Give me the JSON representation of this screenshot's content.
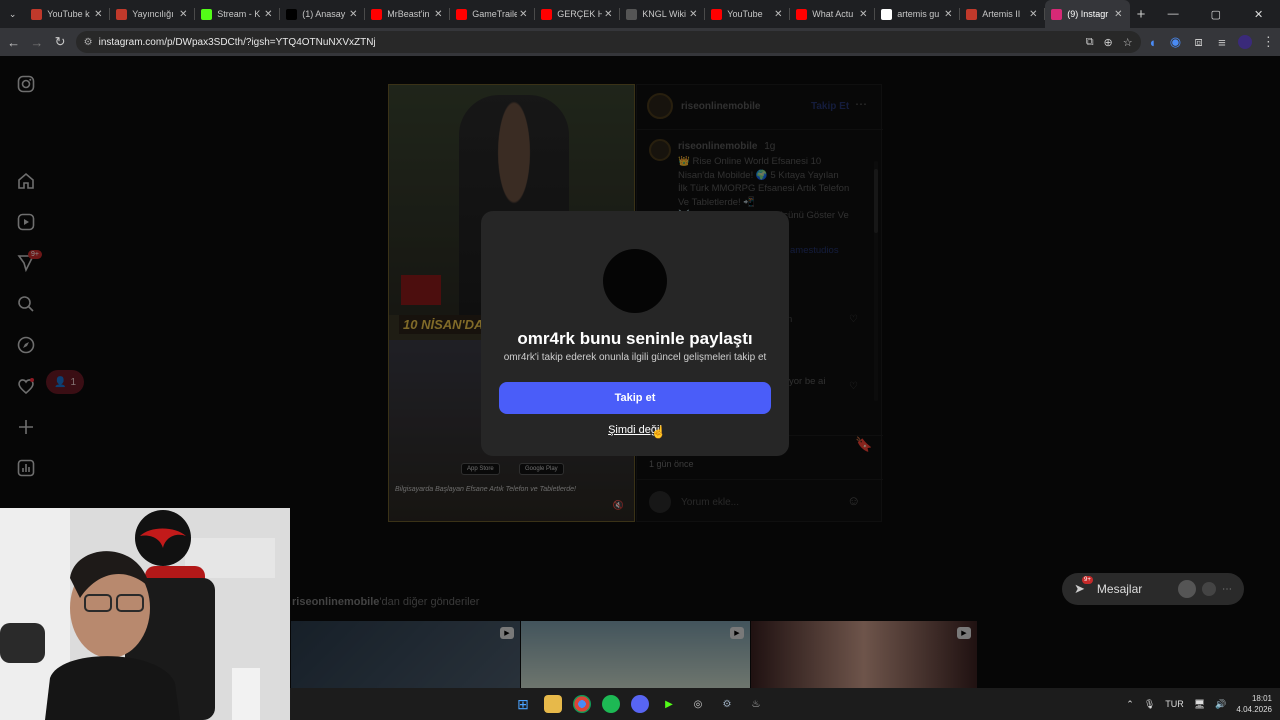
{
  "tabs": [
    {
      "label": "YouTube k",
      "icon": "sparkle-icon",
      "color": "#c0392b"
    },
    {
      "label": "Yayıncılığı",
      "icon": "sparkle-icon",
      "color": "#c0392b"
    },
    {
      "label": "Stream - K",
      "icon": "kick-icon",
      "color": "#53fc18"
    },
    {
      "label": "(1) Anasay",
      "icon": "x-icon",
      "color": "#000000"
    },
    {
      "label": "MrBeast'in",
      "icon": "youtube-icon",
      "color": "#ff0000"
    },
    {
      "label": "GameTraile",
      "icon": "youtube-icon",
      "color": "#ff0000"
    },
    {
      "label": "GERÇEK H",
      "icon": "youtube-icon",
      "color": "#ff0000"
    },
    {
      "label": "KNGL Wiki",
      "icon": "shield-icon",
      "color": "#555555"
    },
    {
      "label": "YouTube",
      "icon": "youtube-icon",
      "color": "#ff0000"
    },
    {
      "label": "What Actu",
      "icon": "youtube-icon",
      "color": "#ff0000"
    },
    {
      "label": "artemis gu",
      "icon": "google-icon",
      "color": "#ffffff"
    },
    {
      "label": "Artemis II",
      "icon": "bookmark-icon",
      "color": "#c0392b"
    },
    {
      "label": "(9) Instagr",
      "icon": "instagram-icon",
      "color": "#d62976",
      "active": true
    }
  ],
  "browser": {
    "url": "instagram.com/p/DWpax3SDCth/?igsh=YTQ4OTNuNXVxZTNj"
  },
  "sidebar": {
    "notification_badge": "9+",
    "activity_count": "1"
  },
  "post": {
    "account": "riseonlinemobile",
    "follow_label": "Takip Et",
    "caption_user": "riseonlinemobile",
    "caption_time": "1g",
    "caption_lines": [
      "👑 Rise Online World Efsanesi 10",
      "Nisan'da Mobilde! 🌍 5 Kıtaya Yayılan",
      "İlk Türk MMORPG Efsanesi Artık Telefon",
      "Ve Tabletlerde! 📲",
      "⚔️ Mücadeleye Katıl, Gücünü Göster Ve",
      "rini Al!"
    ],
    "caption_tag": "amestudios",
    "comment_fragment": "yor be ai",
    "comment_fragment2": "n",
    "date": "1 gün önce",
    "comment_placeholder": "Yorum ekle...",
    "media_banner": "10 NİSAN'DA",
    "media_tagline": "Bilgisayarda Başlayan Efsane Artık Telefon ve Tabletlerde!",
    "store_apple": "App Store",
    "store_google": "Google Play"
  },
  "modal": {
    "title": "omr4rk bunu seninle paylaştı",
    "subtitle": "omr4rk'i takip ederek onunla ilgili güncel gelişmeleri takip et",
    "follow_button": "Takip et",
    "dismiss_button": "Şimdi değil"
  },
  "more_posts": {
    "user": "riseonlinemobile",
    "suffix": "'dan diğer gönderiler"
  },
  "messages": {
    "label": "Mesajlar",
    "badge": "9+"
  },
  "taskbar": {
    "language": "TUR",
    "time": "18:01",
    "date": "4.04.2026"
  }
}
